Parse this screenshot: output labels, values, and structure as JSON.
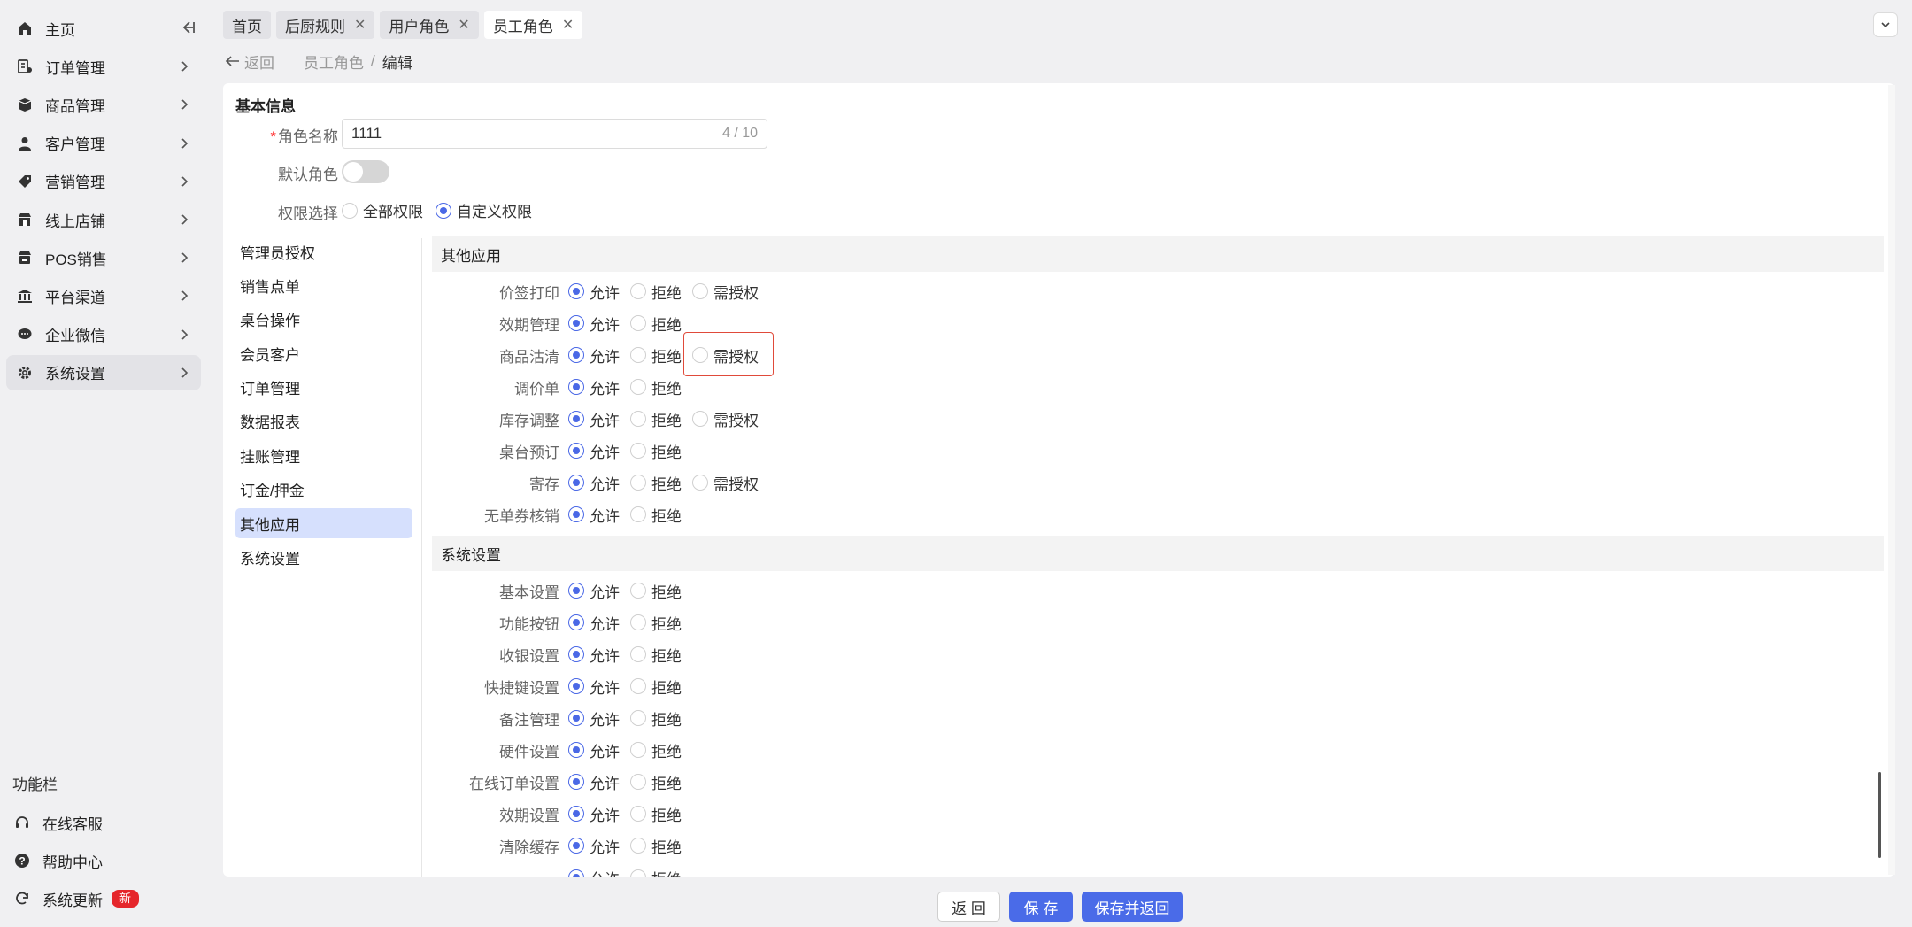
{
  "sidebar": {
    "items": [
      {
        "label": "主页",
        "icon": "home-icon"
      },
      {
        "label": "订单管理",
        "icon": "order-icon"
      },
      {
        "label": "商品管理",
        "icon": "box-icon"
      },
      {
        "label": "客户管理",
        "icon": "user-icon"
      },
      {
        "label": "营销管理",
        "icon": "tag-icon"
      },
      {
        "label": "线上店铺",
        "icon": "store-icon"
      },
      {
        "label": "POS销售",
        "icon": "pos-icon"
      },
      {
        "label": "平台渠道",
        "icon": "bank-icon"
      },
      {
        "label": "企业微信",
        "icon": "chat-icon"
      },
      {
        "label": "系统设置",
        "icon": "gear-icon"
      }
    ],
    "active_index": 9,
    "func_title": "功能栏",
    "func_items": [
      {
        "label": "在线客服",
        "icon": "headset-icon"
      },
      {
        "label": "帮助中心",
        "icon": "help-icon"
      },
      {
        "label": "系统更新",
        "icon": "refresh-icon",
        "badge": "新"
      }
    ]
  },
  "tabs": [
    {
      "label": "首页",
      "closable": false,
      "active": false
    },
    {
      "label": "后厨规则",
      "closable": true,
      "active": false
    },
    {
      "label": "用户角色",
      "closable": true,
      "active": false
    },
    {
      "label": "员工角色",
      "closable": true,
      "active": true
    }
  ],
  "breadcrumb": {
    "back": "返回",
    "parent": "员工角色",
    "sep": "/",
    "current": "编辑"
  },
  "form": {
    "section_title": "基本信息",
    "role_name_label": "角色名称",
    "role_name_value": "1111",
    "role_name_count": "4 / 10",
    "default_role_label": "默认角色",
    "default_role_on": false,
    "perm_select_label": "权限选择",
    "perm_options": [
      {
        "label": "全部权限",
        "checked": false
      },
      {
        "label": "自定义权限",
        "checked": true
      }
    ]
  },
  "categories": [
    "管理员授权",
    "销售点单",
    "桌台操作",
    "会员客户",
    "订单管理",
    "数据报表",
    "挂账管理",
    "订金/押金",
    "其他应用",
    "系统设置"
  ],
  "active_category": 8,
  "option_labels": {
    "allow": "允许",
    "deny": "拒绝",
    "auth": "需授权"
  },
  "groups": [
    {
      "title": "其他应用",
      "rows": [
        {
          "label": "价签打印",
          "auth": true
        },
        {
          "label": "效期管理",
          "auth": false
        },
        {
          "label": "商品沽清",
          "auth": true
        },
        {
          "label": "调价单",
          "auth": false
        },
        {
          "label": "库存调整",
          "auth": true
        },
        {
          "label": "桌台预订",
          "auth": false
        },
        {
          "label": "寄存",
          "auth": true
        },
        {
          "label": "无单券核销",
          "auth": false
        }
      ]
    },
    {
      "title": "系统设置",
      "rows": [
        {
          "label": "基本设置",
          "auth": false
        },
        {
          "label": "功能按钮",
          "auth": false
        },
        {
          "label": "收银设置",
          "auth": false
        },
        {
          "label": "快捷键设置",
          "auth": false
        },
        {
          "label": "备注管理",
          "auth": false
        },
        {
          "label": "硬件设置",
          "auth": false
        },
        {
          "label": "在线订单设置",
          "auth": false
        },
        {
          "label": "效期设置",
          "auth": false
        },
        {
          "label": "清除缓存",
          "auth": false
        },
        {
          "label": "",
          "auth": false
        }
      ]
    }
  ],
  "footer": {
    "back": "返 回",
    "save": "保 存",
    "save_back": "保存并返回"
  },
  "colors": {
    "accent": "#4a6be8",
    "highlight": "#e04a3a",
    "badge": "#e5262b"
  }
}
